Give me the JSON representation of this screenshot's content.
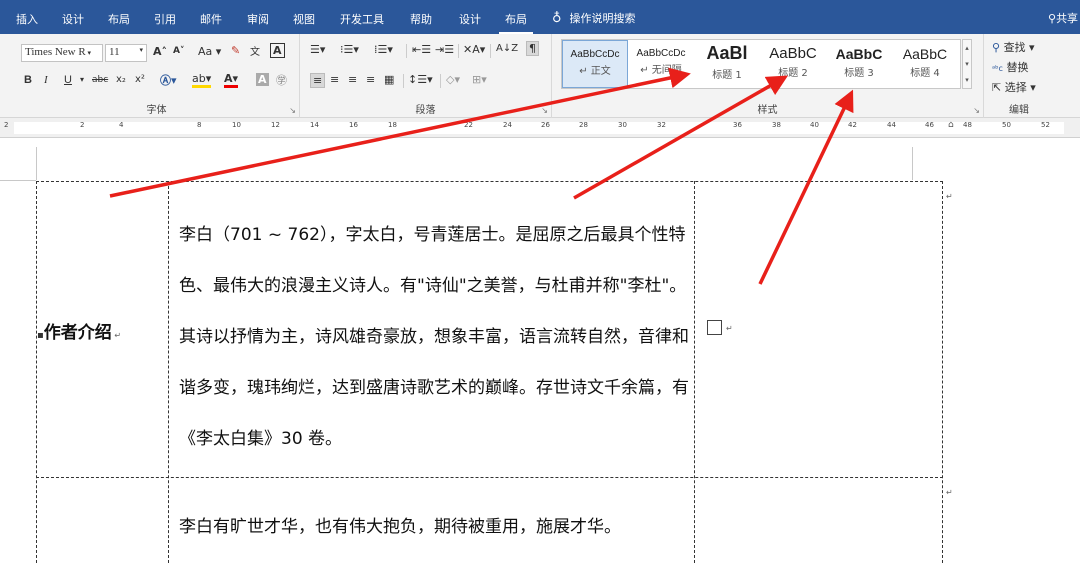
{
  "tabs": {
    "insert": "插入",
    "design1": "设计",
    "layout1": "布局",
    "references": "引用",
    "mailings": "邮件",
    "review": "审阅",
    "view": "视图",
    "developer": "开发工具",
    "help": "帮助",
    "design2": "设计",
    "layout2": "布局"
  },
  "tellme": "操作说明搜索",
  "share": "共享",
  "font": {
    "name": "Times New R",
    "size": "11",
    "bold": "B",
    "italic": "I",
    "underline": "U",
    "strike": "abc",
    "sub": "x₂",
    "sup": "x²",
    "group": "字体",
    "aa": "Aa"
  },
  "paragraph": {
    "group": "段落"
  },
  "styles": {
    "group": "样式",
    "items": [
      {
        "preview": "AaBbCcDc",
        "name": "↵ 正文"
      },
      {
        "preview": "AaBbCcDc",
        "name": "↵ 无间隔"
      },
      {
        "preview": "AaBl",
        "name": "标题 1"
      },
      {
        "preview": "AaBbC",
        "name": "标题 2"
      },
      {
        "preview": "AaBbC",
        "name": "标题 3"
      },
      {
        "preview": "AaBbC",
        "name": "标题 4"
      }
    ]
  },
  "editing": {
    "group": "编辑",
    "find": "查找",
    "replace": "替换",
    "select": "选择"
  },
  "ruler": [
    "2",
    "2",
    "4",
    "8",
    "10",
    "12",
    "14",
    "16",
    "18",
    "22",
    "24",
    "26",
    "28",
    "30",
    "32",
    "36",
    "38",
    "40",
    "42",
    "44",
    "46",
    "48",
    "50",
    "52"
  ],
  "doc": {
    "label": "作者介绍",
    "para1": "李白（701 ~ 762），字太白，号青莲居士。是屈原之后最具个性特色、最伟大的浪漫主义诗人。有\"诗仙\"之美誉，与杜甫并称\"李杜\"。其诗以抒情为主，诗风雄奇豪放，想象丰富，语言流转自然，音律和谐多变，瑰玮绚烂，达到盛唐诗歌艺术的巅峰。存世诗文千余篇，有《李太白集》30 卷。",
    "para2": "李白有旷世才华，也有伟大抱负，期待被重用，施展才华。"
  },
  "colors": {
    "accent": "#2b579a",
    "arrow": "#e8201a"
  }
}
